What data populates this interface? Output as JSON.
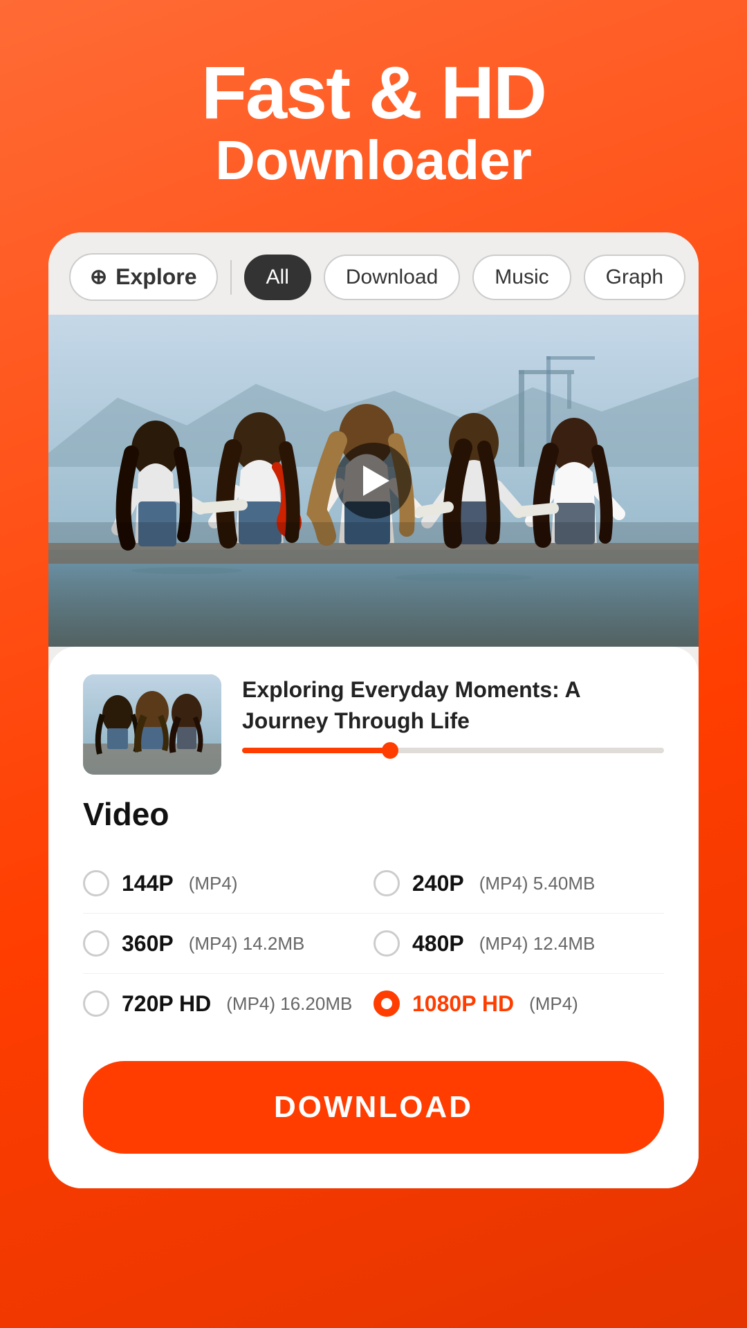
{
  "header": {
    "title_line1": "Fast & HD",
    "title_line2": "Downloader"
  },
  "nav": {
    "explore_label": "Explore",
    "pills": [
      {
        "label": "All",
        "active": true
      },
      {
        "label": "Download",
        "active": false
      },
      {
        "label": "Music",
        "active": false
      },
      {
        "label": "Graph",
        "active": false
      }
    ]
  },
  "video": {
    "title": "Exploring Everyday Moments: A Journey Through Life",
    "progress_percent": 35,
    "section_label": "Video",
    "qualities": [
      {
        "label": "144P",
        "detail": "(MP4)",
        "size": "",
        "selected": false,
        "col": 1
      },
      {
        "label": "240P",
        "detail": "(MP4)",
        "size": "5.40MB",
        "selected": false,
        "col": 2
      },
      {
        "label": "360P",
        "detail": "(MP4)",
        "size": "14.2MB",
        "selected": false,
        "col": 1
      },
      {
        "label": "480P",
        "detail": "(MP4)",
        "size": "12.4MB",
        "selected": false,
        "col": 2
      },
      {
        "label": "720P HD",
        "detail": "(MP4)",
        "size": "16.20MB",
        "selected": false,
        "col": 1
      },
      {
        "label": "1080P HD",
        "detail": "(MP4)",
        "size": "",
        "selected": true,
        "col": 2
      }
    ],
    "download_button_label": "DOWNLOAD"
  }
}
